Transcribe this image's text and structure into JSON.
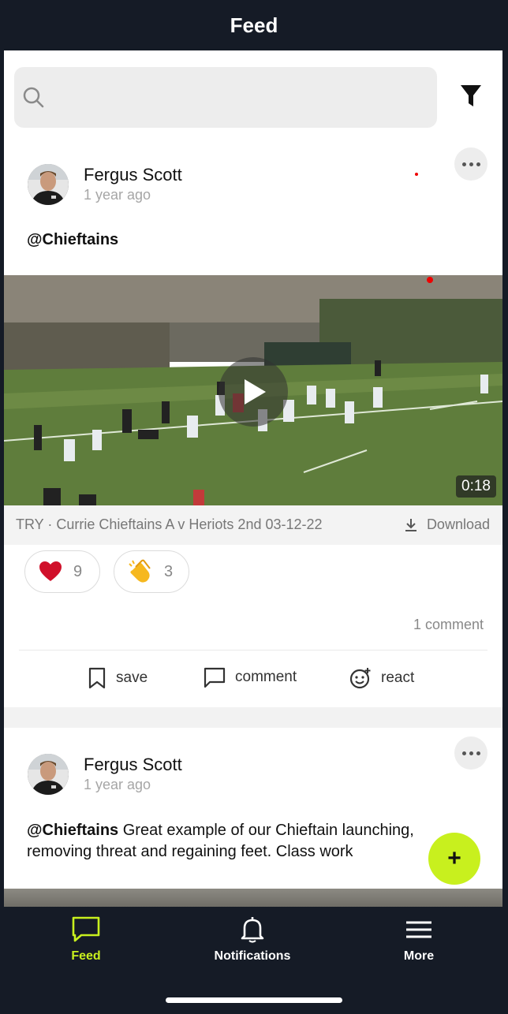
{
  "header": {
    "title": "Feed"
  },
  "search": {
    "placeholder": ""
  },
  "posts": [
    {
      "author": "Fergus Scott",
      "time": "1 year ago",
      "mention": "@Chieftains",
      "text": "",
      "video": {
        "duration": "0:18",
        "title": "TRY · Currie Chieftains A v Heriots 2nd 03-12-22",
        "download_label": "Download"
      },
      "reactions": [
        {
          "icon": "heart-icon",
          "count": "9"
        },
        {
          "icon": "clapping-hands-icon",
          "count": "3"
        }
      ],
      "comments_count": "1 comment",
      "actions": {
        "save": "save",
        "comment": "comment",
        "react": "react"
      }
    },
    {
      "author": "Fergus Scott",
      "time": "1 year ago",
      "mention": "@Chieftains",
      "text": " Great example of our Chieftain launching, removing threat and regaining feet. Class work"
    }
  ],
  "fab": {
    "label": "+"
  },
  "tabbar": {
    "tabs": [
      {
        "label": "Feed",
        "icon": "speech-bubble-icon",
        "active": true
      },
      {
        "label": "Notifications",
        "icon": "bell-icon",
        "active": false
      },
      {
        "label": "More",
        "icon": "menu-icon",
        "active": false
      }
    ]
  },
  "colors": {
    "accent": "#c8f01e",
    "bar_background": "#151b26",
    "heart": "#d0102a"
  }
}
